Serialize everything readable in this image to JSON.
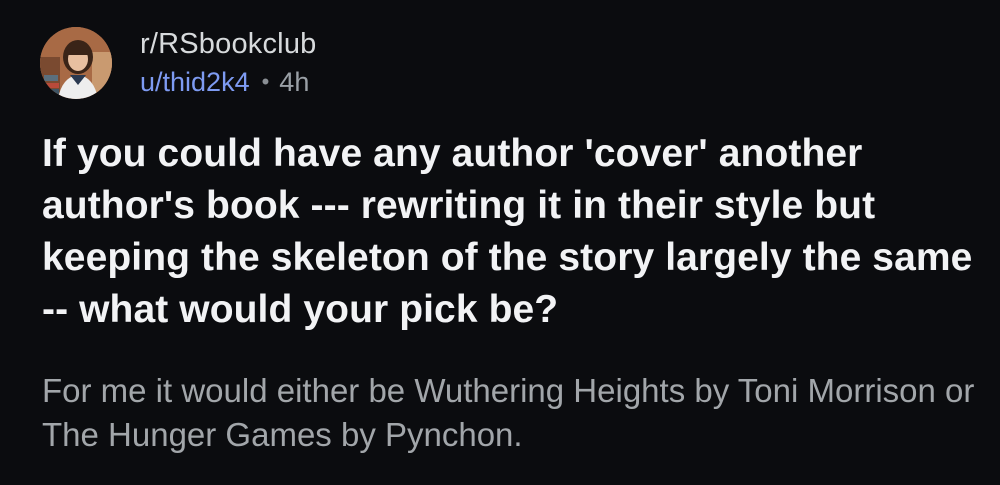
{
  "post": {
    "subreddit": "r/RSbookclub",
    "username": "u/thid2k4",
    "separator": "•",
    "age": "4h",
    "title": "If you could have any author 'cover' another author's book --- rewriting it in their style but keeping the skeleton of the story largely the same -- what would your pick be?",
    "body": "For me it would either be Wuthering Heights by Toni Morrison or The Hunger Games by Pynchon.",
    "avatar_icon": "user-avatar-icon"
  },
  "colors": {
    "background": "#0b0c0f",
    "title": "#f2f3f5",
    "body": "#a2a6aa",
    "username": "#7e9bf2",
    "meta": "#9aa0a6"
  }
}
